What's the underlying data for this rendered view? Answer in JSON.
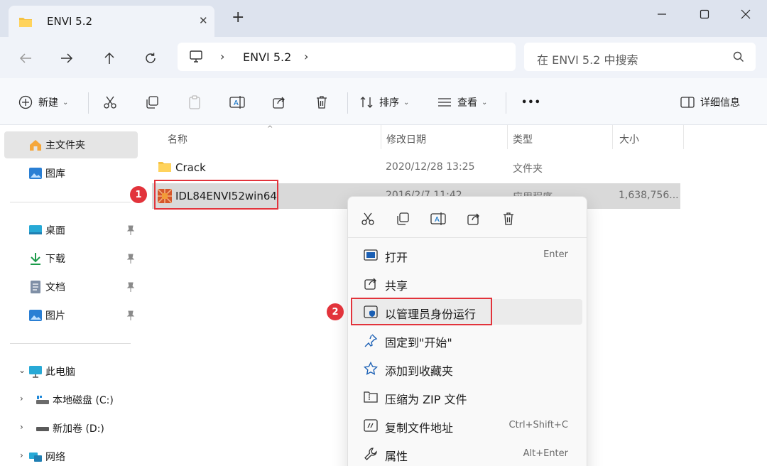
{
  "window": {
    "tab_title": "ENVI 5.2",
    "close_tab": "✕",
    "new_tab": "+"
  },
  "address": {
    "crumbs": [
      "ENVI 5.2"
    ],
    "search_placeholder": "在 ENVI 5.2 中搜索"
  },
  "toolbar": {
    "new_label": "新建",
    "sort_label": "排序",
    "view_label": "查看",
    "more_label": "•••",
    "details_label": "详细信息"
  },
  "sidebar": {
    "home": "主文件夹",
    "gallery": "图库",
    "quick": [
      "桌面",
      "下载",
      "文档",
      "图片"
    ],
    "this_pc": "此电脑",
    "drives": [
      "本地磁盘 (C:)",
      "新加卷 (D:)"
    ],
    "network": "网络"
  },
  "list": {
    "headers": [
      "名称",
      "修改日期",
      "类型",
      "大小"
    ],
    "rows": [
      {
        "name": "Crack",
        "date": "2020/12/28 13:25",
        "type": "文件夹",
        "size": ""
      },
      {
        "name": "IDL84ENVI52win64",
        "date": "2016/2/7 11:42",
        "type": "应用程序",
        "size": "1,638,756..."
      }
    ]
  },
  "annotations": {
    "badge1": "1",
    "badge2": "2"
  },
  "context_menu": {
    "items": [
      {
        "label": "打开",
        "shortcut": "Enter"
      },
      {
        "label": "共享",
        "shortcut": ""
      },
      {
        "label": "以管理员身份运行",
        "shortcut": ""
      },
      {
        "label": "固定到\"开始\"",
        "shortcut": ""
      },
      {
        "label": "添加到收藏夹",
        "shortcut": ""
      },
      {
        "label": "压缩为 ZIP 文件",
        "shortcut": ""
      },
      {
        "label": "复制文件地址",
        "shortcut": "Ctrl+Shift+C"
      },
      {
        "label": "属性",
        "shortcut": "Alt+Enter"
      }
    ]
  },
  "colors": {
    "accent": "#0067c0",
    "folder": "#f5c242",
    "annotation": "#e2333b",
    "selection": "#d9d9d9"
  }
}
